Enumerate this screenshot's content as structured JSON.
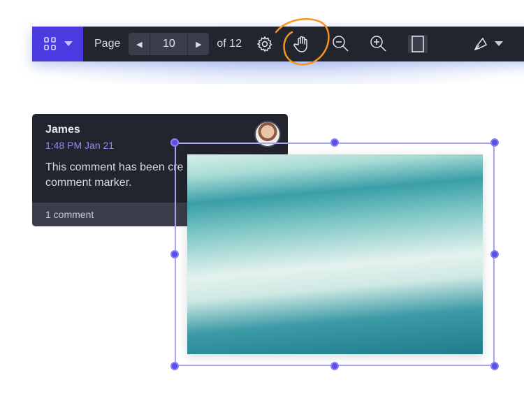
{
  "toolbar": {
    "page_label": "Page",
    "page_value": "10",
    "page_total": "of 12",
    "accent": "#4b3ae0",
    "icons": [
      "grid-icon",
      "chevron-down-icon",
      "prev-page-icon",
      "next-page-icon",
      "gear-icon",
      "hand-pan-icon",
      "zoom-out-icon",
      "zoom-in-icon",
      "page-layout-icon",
      "pen-tool-icon"
    ]
  },
  "comment": {
    "author": "James",
    "time": "1:48 PM Jan 21",
    "body_line1": "This comment has been cre",
    "body_line2": "comment marker.",
    "footer": "1 comment"
  },
  "selection": {
    "color": "#5b4ee8"
  },
  "highlight": {
    "color": "#f7941d"
  }
}
